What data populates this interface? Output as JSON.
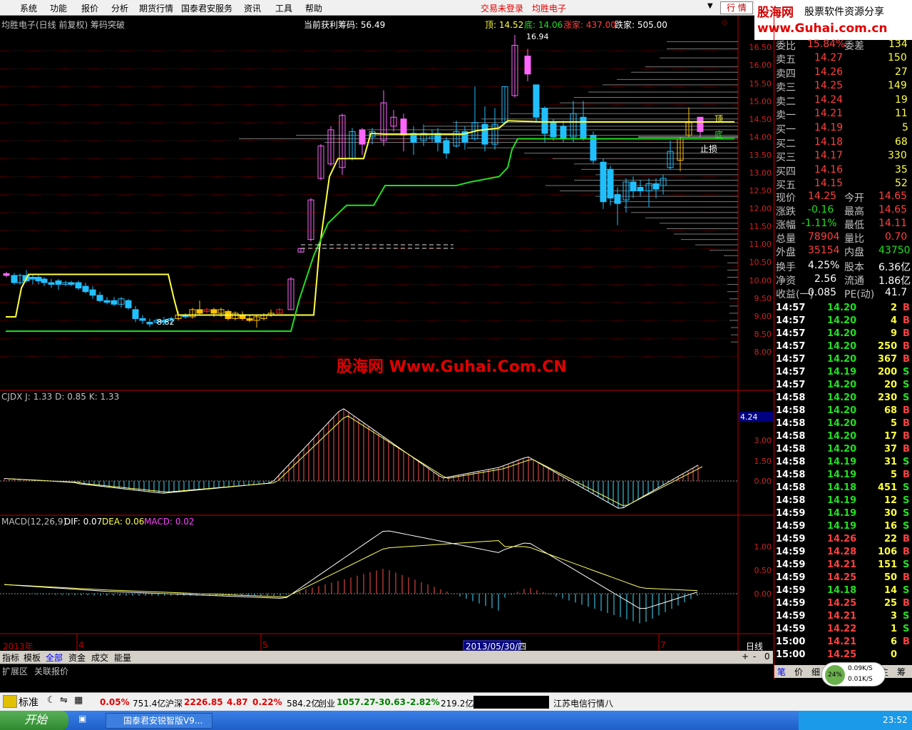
{
  "menu": {
    "items": [
      "系统",
      "功能",
      "报价",
      "分析",
      "期货行情",
      "国泰君安服务",
      "资讯",
      "工具",
      "帮助"
    ],
    "trade_status": "交易未登录",
    "stock_name_red": "均胜电子",
    "quote_button": "行 情"
  },
  "brand": {
    "line1": "股海网",
    "line2": "股票软件资源分享",
    "line3": "www.Guhai.com.cn"
  },
  "chart_header": {
    "title": "均胜电子(日线 前复权) 筹码突破",
    "profit_chip": "当前获利筹码: 56.49",
    "top_label": "顶: 14.52",
    "bottom_label": "底: 14.06",
    "rise_label": "涨家: 437.00",
    "fall_label": "跌家: 505.00"
  },
  "watermark": "股海网 Www.Guhai.Com.CN",
  "price_axis": [
    "16.50",
    "16.00",
    "15.50",
    "15.00",
    "14.50",
    "14.00",
    "13.50",
    "13.00",
    "12.50",
    "12.00",
    "11.50",
    "11.00",
    "10.50",
    "10.00",
    "9.50",
    "9.00",
    "8.50",
    "8.00"
  ],
  "annotations": {
    "high": "16.94",
    "low": "8.82",
    "top_mark": "顶",
    "bottom_mark": "底",
    "stop_loss": "止损"
  },
  "cjdx": {
    "header": "CJDX J: 1.33  D: 0.85  K: 1.33",
    "axis": [
      "4.24",
      "3.00",
      "1.50",
      "0.00"
    ]
  },
  "macd": {
    "label": "MACD(12,26,9)",
    "dif": "DIF: 0.07",
    "dea": "DEA: 0.06",
    "macd": "MACD: 0.02",
    "axis": [
      "1.00",
      "0.50",
      "0.00"
    ]
  },
  "time_axis": {
    "year": "2013年",
    "m4": "4",
    "m5": "5",
    "cursor_date": "2013/05/30/四",
    "m7": "7",
    "period": "日线"
  },
  "quote": {
    "ratio": {
      "label": "委比",
      "value": "15.84%",
      "label2": "委差",
      "value2": "134"
    },
    "sells": [
      {
        "label": "卖五",
        "price": "14.27",
        "vol": "150"
      },
      {
        "label": "卖四",
        "price": "14.26",
        "vol": "27"
      },
      {
        "label": "卖三",
        "price": "14.25",
        "vol": "149"
      },
      {
        "label": "卖二",
        "price": "14.24",
        "vol": "19"
      },
      {
        "label": "卖一",
        "price": "14.21",
        "vol": "11"
      }
    ],
    "buys": [
      {
        "label": "买一",
        "price": "14.19",
        "vol": "5"
      },
      {
        "label": "买二",
        "price": "14.18",
        "vol": "68"
      },
      {
        "label": "买三",
        "price": "14.17",
        "vol": "330"
      },
      {
        "label": "买四",
        "price": "14.16",
        "vol": "35"
      },
      {
        "label": "买五",
        "price": "14.15",
        "vol": "52"
      }
    ],
    "stats": [
      {
        "l1": "现价",
        "v1": "14.25",
        "l2": "今开",
        "v2": "14.65"
      },
      {
        "l1": "涨跌",
        "v1": "-0.16",
        "l2": "最高",
        "v2": "14.65"
      },
      {
        "l1": "涨幅",
        "v1": "-1.11%",
        "l2": "最低",
        "v2": "14.11"
      },
      {
        "l1": "总量",
        "v1": "78904",
        "l2": "量比",
        "v2": "0.70"
      },
      {
        "l1": "外盘",
        "v1": "35154",
        "l2": "内盘",
        "v2": "43750"
      },
      {
        "l1": "换手",
        "v1": "4.25%",
        "l2": "股本",
        "v2": "6.36亿"
      },
      {
        "l1": "净资",
        "v1": "2.56",
        "l2": "流通",
        "v2": "1.86亿"
      },
      {
        "l1": "收益(一)",
        "v1": "0.085",
        "l2": "PE(动)",
        "v2": "41.7"
      }
    ],
    "ticks": [
      {
        "t": "14:57",
        "p": "14.20",
        "v": "2",
        "d": "B"
      },
      {
        "t": "14:57",
        "p": "14.20",
        "v": "4",
        "d": "B"
      },
      {
        "t": "14:57",
        "p": "14.20",
        "v": "9",
        "d": "B"
      },
      {
        "t": "14:57",
        "p": "14.20",
        "v": "250",
        "d": "B"
      },
      {
        "t": "14:57",
        "p": "14.20",
        "v": "367",
        "d": "B"
      },
      {
        "t": "14:57",
        "p": "14.19",
        "v": "200",
        "d": "S"
      },
      {
        "t": "14:57",
        "p": "14.20",
        "v": "20",
        "d": "S"
      },
      {
        "t": "14:58",
        "p": "14.20",
        "v": "230",
        "d": "S"
      },
      {
        "t": "14:58",
        "p": "14.20",
        "v": "68",
        "d": "B"
      },
      {
        "t": "14:58",
        "p": "14.20",
        "v": "5",
        "d": "B"
      },
      {
        "t": "14:58",
        "p": "14.20",
        "v": "17",
        "d": "B"
      },
      {
        "t": "14:58",
        "p": "14.20",
        "v": "37",
        "d": "B"
      },
      {
        "t": "14:58",
        "p": "14.19",
        "v": "31",
        "d": "S"
      },
      {
        "t": "14:58",
        "p": "14.19",
        "v": "5",
        "d": "B"
      },
      {
        "t": "14:58",
        "p": "14.18",
        "v": "451",
        "d": "S"
      },
      {
        "t": "14:58",
        "p": "14.19",
        "v": "12",
        "d": "S"
      },
      {
        "t": "14:59",
        "p": "14.19",
        "v": "30",
        "d": "S"
      },
      {
        "t": "14:59",
        "p": "14.19",
        "v": "16",
        "d": "S"
      },
      {
        "t": "14:59",
        "p": "14.26",
        "v": "22",
        "d": "B"
      },
      {
        "t": "14:59",
        "p": "14.28",
        "v": "106",
        "d": "B"
      },
      {
        "t": "14:59",
        "p": "14.21",
        "v": "151",
        "d": "S"
      },
      {
        "t": "14:59",
        "p": "14.25",
        "v": "50",
        "d": "B"
      },
      {
        "t": "14:59",
        "p": "14.18",
        "v": "14",
        "d": "S"
      },
      {
        "t": "14:59",
        "p": "14.25",
        "v": "25",
        "d": "B"
      },
      {
        "t": "14:59",
        "p": "14.21",
        "v": "3",
        "d": "S"
      },
      {
        "t": "14:59",
        "p": "14.22",
        "v": "1",
        "d": "S"
      },
      {
        "t": "15:00",
        "p": "14.21",
        "v": "6",
        "d": "B"
      },
      {
        "t": "15:00",
        "p": "14.25",
        "v": "0",
        "d": ""
      }
    ],
    "tabs": [
      "笔",
      "价",
      "细",
      "势",
      "联",
      "值",
      "主",
      "筹"
    ]
  },
  "bottom_tabs": [
    "指标",
    "模板",
    "全部",
    "资金",
    "成交",
    "能量"
  ],
  "bottom_tabs2": [
    "扩展区",
    "关联报价"
  ],
  "status": {
    "std": "标准",
    "sh_pct": "0.05%",
    "sh_amt": "751.4亿",
    "sz_label": "沪深",
    "sz_val": "2226.85",
    "sz_chg": "4.87",
    "sz_pct": "0.22%",
    "sz_amt": "584.2亿",
    "cy_label": "创业",
    "cy_val": "1057.27",
    "cy_chg": "-30.63",
    "cy_pct": "-2.82%",
    "cy_amt": "219.2亿",
    "news": "江苏电信行情八"
  },
  "net": {
    "pct": "24%",
    "up": "0.09K/S",
    "down": "0.01K/S"
  },
  "taskbar": {
    "start": "开始",
    "app": "国泰君安锐智版V9...",
    "clock": "23:52"
  },
  "scale_buttons": [
    "+",
    "-",
    "0"
  ]
}
